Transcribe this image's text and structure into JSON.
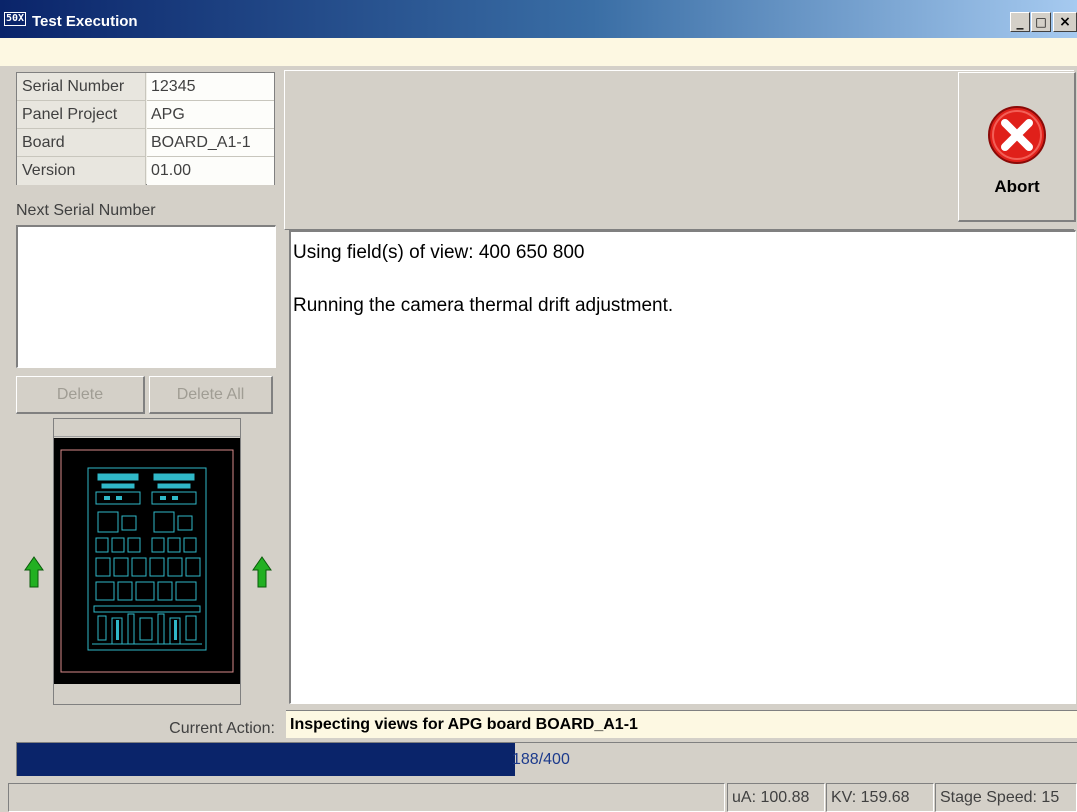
{
  "window": {
    "app_icon_text": "50X",
    "title": "Test Execution",
    "minimize_glyph": "_",
    "maximize_glyph": "□",
    "close_glyph": "×"
  },
  "info": {
    "rows": [
      {
        "label": "Serial Number",
        "value": "12345"
      },
      {
        "label": "Panel Project",
        "value": "APG"
      },
      {
        "label": "Board",
        "value": "BOARD_A1-1"
      },
      {
        "label": "Version",
        "value": "01.00"
      }
    ]
  },
  "next_serial": {
    "label": "Next Serial Number",
    "delete_label": "Delete",
    "delete_all_label": "Delete All"
  },
  "abort": {
    "label": "Abort",
    "icon": "error-x-icon",
    "color": "#e0201a"
  },
  "log": {
    "lines": [
      "Using field(s) of view:  400 650 800",
      "Running the camera thermal drift adjustment."
    ]
  },
  "current_action": {
    "label": "Current Action:",
    "value": "Inspecting views for APG board BOARD_A1-1"
  },
  "progress": {
    "text": "188/400",
    "current": 188,
    "total": 400,
    "color": "#0a246a"
  },
  "status": {
    "ua": "uA: 100.88",
    "kv": "KV: 159.68",
    "stage_speed": "Stage Speed: 15"
  },
  "colors": {
    "board_trace": "#30b8c8",
    "arrow": "#22b022"
  }
}
